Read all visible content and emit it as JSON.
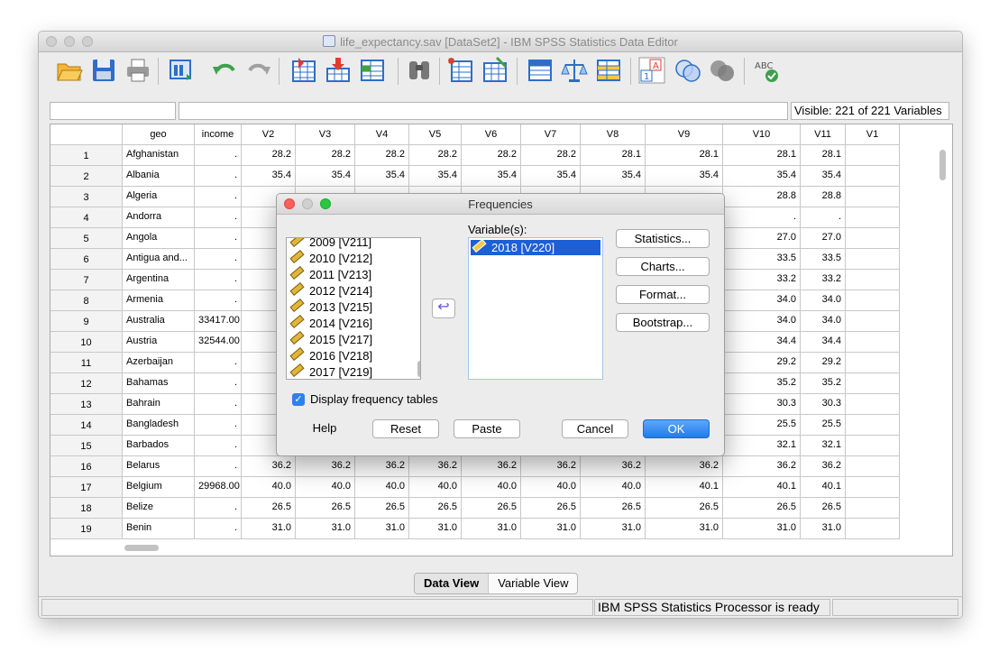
{
  "window": {
    "title": "life_expectancy.sav [DataSet2] - IBM SPSS Statistics Data Editor"
  },
  "toolbar": {
    "icons": [
      "open-icon",
      "save-icon",
      "print-icon",
      "recall-dialog-icon",
      "undo-icon",
      "redo-icon",
      "goto-case-icon",
      "goto-variable-icon",
      "variables-icon",
      "find-icon",
      "insert-cases-icon",
      "insert-variable-icon",
      "split-file-icon",
      "weight-cases-icon",
      "select-cases-icon",
      "value-labels-icon",
      "use-sets-icon",
      "show-all-variables-icon",
      "spell-check-icon"
    ]
  },
  "cell_editor": {
    "name": "",
    "value": ""
  },
  "visible_variables": "Visible: 221 of 221 Variables",
  "grid": {
    "columns": [
      "geo",
      "income",
      "V2",
      "V3",
      "V4",
      "V5",
      "V6",
      "V7",
      "V8",
      "V9",
      "V10",
      "V11",
      "V1"
    ],
    "rows": [
      {
        "n": "1",
        "cells": [
          "Afghanistan",
          ".",
          "28.2",
          "28.2",
          "28.2",
          "28.2",
          "28.2",
          "28.2",
          "28.1",
          "28.1",
          "28.1",
          "28.1"
        ]
      },
      {
        "n": "2",
        "cells": [
          "Albania",
          ".",
          "35.4",
          "35.4",
          "35.4",
          "35.4",
          "35.4",
          "35.4",
          "35.4",
          "35.4",
          "35.4",
          "35.4"
        ]
      },
      {
        "n": "3",
        "cells": [
          "Algeria",
          ".",
          "",
          "",
          "",
          "",
          "",
          "",
          "",
          "",
          "28.8",
          "28.8"
        ]
      },
      {
        "n": "4",
        "cells": [
          "Andorra",
          ".",
          "",
          "",
          "",
          "",
          "",
          "",
          "",
          "",
          ".",
          "."
        ]
      },
      {
        "n": "5",
        "cells": [
          "Angola",
          ".",
          "",
          "",
          "",
          "",
          "",
          "",
          "",
          "",
          "27.0",
          "27.0"
        ]
      },
      {
        "n": "6",
        "cells": [
          "Antigua and...",
          ".",
          "",
          "",
          "",
          "",
          "",
          "",
          "",
          "",
          "33.5",
          "33.5"
        ]
      },
      {
        "n": "7",
        "cells": [
          "Argentina",
          ".",
          "",
          "",
          "",
          "",
          "",
          "",
          "",
          "",
          "33.2",
          "33.2"
        ]
      },
      {
        "n": "8",
        "cells": [
          "Armenia",
          ".",
          "",
          "",
          "",
          "",
          "",
          "",
          "",
          "",
          "34.0",
          "34.0"
        ]
      },
      {
        "n": "9",
        "cells": [
          "Australia",
          "33417.00",
          "",
          "",
          "",
          "",
          "",
          "",
          "",
          "",
          "34.0",
          "34.0"
        ]
      },
      {
        "n": "10",
        "cells": [
          "Austria",
          "32544.00",
          "",
          "",
          "",
          "",
          "",
          "",
          "",
          "",
          "34.4",
          "34.4"
        ]
      },
      {
        "n": "11",
        "cells": [
          "Azerbaijan",
          ".",
          "",
          "",
          "",
          "",
          "",
          "",
          "",
          "",
          "29.2",
          "29.2"
        ]
      },
      {
        "n": "12",
        "cells": [
          "Bahamas",
          ".",
          "",
          "",
          "",
          "",
          "",
          "",
          "",
          "",
          "35.2",
          "35.2"
        ]
      },
      {
        "n": "13",
        "cells": [
          "Bahrain",
          ".",
          "",
          "",
          "",
          "",
          "",
          "",
          "",
          "",
          "30.3",
          "30.3"
        ]
      },
      {
        "n": "14",
        "cells": [
          "Bangladesh",
          ".",
          "",
          "",
          "",
          "",
          "",
          "",
          "",
          "",
          "25.5",
          "25.5"
        ]
      },
      {
        "n": "15",
        "cells": [
          "Barbados",
          ".",
          "",
          "",
          "",
          "",
          "",
          "",
          "",
          "",
          "32.1",
          "32.1"
        ]
      },
      {
        "n": "16",
        "cells": [
          "Belarus",
          ".",
          "36.2",
          "36.2",
          "36.2",
          "36.2",
          "36.2",
          "36.2",
          "36.2",
          "36.2",
          "36.2",
          "36.2"
        ]
      },
      {
        "n": "17",
        "cells": [
          "Belgium",
          "29968.00",
          "40.0",
          "40.0",
          "40.0",
          "40.0",
          "40.0",
          "40.0",
          "40.0",
          "40.1",
          "40.1",
          "40.1"
        ]
      },
      {
        "n": "18",
        "cells": [
          "Belize",
          ".",
          "26.5",
          "26.5",
          "26.5",
          "26.5",
          "26.5",
          "26.5",
          "26.5",
          "26.5",
          "26.5",
          "26.5"
        ]
      },
      {
        "n": "19",
        "cells": [
          "Benin",
          ".",
          "31.0",
          "31.0",
          "31.0",
          "31.0",
          "31.0",
          "31.0",
          "31.0",
          "31.0",
          "31.0",
          "31.0"
        ]
      }
    ]
  },
  "tabs": [
    {
      "label": "Data View",
      "active": true
    },
    {
      "label": "Variable View",
      "active": false
    }
  ],
  "status": {
    "text": "IBM SPSS Statistics Processor is ready"
  },
  "dialog": {
    "title": "Frequencies",
    "source_items": [
      "2009 [V211]",
      "2010 [V212]",
      "2011 [V213]",
      "2012 [V214]",
      "2013 [V215]",
      "2014 [V216]",
      "2015 [V217]",
      "2016 [V218]",
      "2017 [V219]"
    ],
    "variables_label": "Variable(s):",
    "selected_items": [
      "2018 [V220]"
    ],
    "side_buttons": [
      "Statistics...",
      "Charts...",
      "Format...",
      "Bootstrap..."
    ],
    "checkbox_label": "Display frequency tables",
    "checkbox_checked": true,
    "bottom_buttons": {
      "help": "Help",
      "reset": "Reset",
      "paste": "Paste",
      "cancel": "Cancel",
      "ok": "OK"
    },
    "accent_color": "#1f7bef"
  }
}
